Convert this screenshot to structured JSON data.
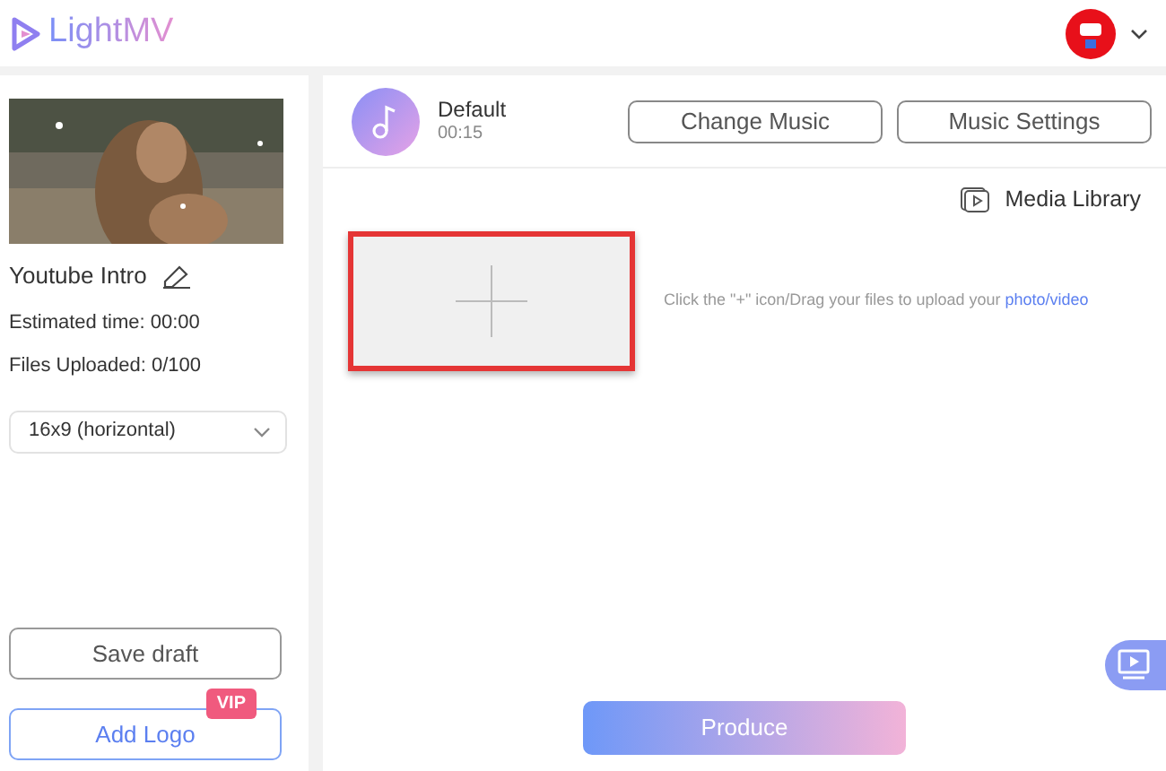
{
  "header": {
    "logo_text": "LightMV"
  },
  "sidebar": {
    "project_title": "Youtube Intro",
    "estimated_time": {
      "label": "Estimated time:",
      "value": "00:00"
    },
    "files_uploaded": {
      "label": "Files Uploaded:",
      "value": "0/100"
    },
    "aspect_select": {
      "value": "16x9 (horizontal)"
    },
    "save_button": "Save draft",
    "logo_button": {
      "label": "Add Logo",
      "badge": "VIP"
    }
  },
  "music": {
    "name": "Default",
    "duration": "00:15",
    "buttons": [
      "Change Music",
      "Music Settings"
    ]
  },
  "media_library": "Media Library",
  "upload": {
    "hint": "Click the \"+\" icon/Drag your files to upload your",
    "hint_link": "photo/video"
  },
  "produce_button": "Produce"
}
